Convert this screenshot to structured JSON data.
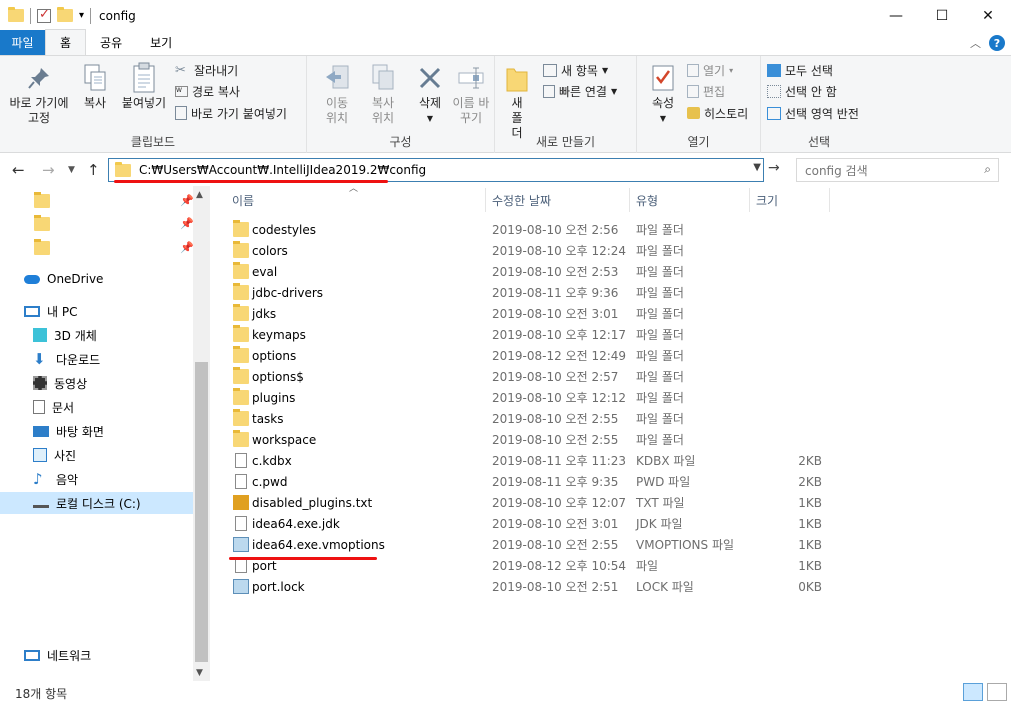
{
  "window": {
    "title": "config",
    "minimize": "—",
    "maximize": "☐",
    "close": "✕"
  },
  "ribbon_tabs": [
    "파일",
    "홈",
    "공유",
    "보기"
  ],
  "ribbon": {
    "clipboard": {
      "label": "클립보드",
      "pin": "바로 가기에 고정",
      "copy": "복사",
      "paste": "붙여넣기",
      "cut": "잘라내기",
      "copy_path": "경로 복사",
      "paste_shortcut": "바로 가기 붙여넣기"
    },
    "organize": {
      "label": "구성",
      "move_to": "이동 위치",
      "copy_to": "복사 위치",
      "delete": "삭제",
      "rename": "이름 바꾸기"
    },
    "new": {
      "label": "새로 만들기",
      "new_folder": "새 폴더",
      "new_item": "새 항목",
      "easy_access": "빠른 연결"
    },
    "open": {
      "label": "열기",
      "properties": "속성",
      "open": "열기",
      "edit": "편집",
      "history": "히스토리"
    },
    "select": {
      "label": "선택",
      "select_all": "모두 선택",
      "select_none": "선택 안 함",
      "invert": "선택 영역 반전"
    }
  },
  "address": {
    "path": "C:₩Users₩Account₩.IntelliJIdea2019.2₩config",
    "search_placeholder": "config 검색"
  },
  "nav_pane": {
    "onedrive": "OneDrive",
    "this_pc": "내 PC",
    "items": [
      "3D 개체",
      "다운로드",
      "동영상",
      "문서",
      "바탕 화면",
      "사진",
      "음악",
      "로컬 디스크 (C:)"
    ],
    "network": "네트워크"
  },
  "columns": {
    "name": "이름",
    "date": "수정한 날짜",
    "type": "유형",
    "size": "크기"
  },
  "files": [
    {
      "name": "codestyles",
      "date": "2019-08-10 오전 2:56",
      "type": "파일 폴더",
      "size": "",
      "kind": "folder"
    },
    {
      "name": "colors",
      "date": "2019-08-10 오후 12:24",
      "type": "파일 폴더",
      "size": "",
      "kind": "folder"
    },
    {
      "name": "eval",
      "date": "2019-08-10 오전 2:53",
      "type": "파일 폴더",
      "size": "",
      "kind": "folder"
    },
    {
      "name": "jdbc-drivers",
      "date": "2019-08-11 오후 9:36",
      "type": "파일 폴더",
      "size": "",
      "kind": "folder"
    },
    {
      "name": "jdks",
      "date": "2019-08-10 오전 3:01",
      "type": "파일 폴더",
      "size": "",
      "kind": "folder"
    },
    {
      "name": "keymaps",
      "date": "2019-08-10 오후 12:17",
      "type": "파일 폴더",
      "size": "",
      "kind": "folder"
    },
    {
      "name": "options",
      "date": "2019-08-12 오전 12:49",
      "type": "파일 폴더",
      "size": "",
      "kind": "folder"
    },
    {
      "name": "options$",
      "date": "2019-08-10 오전 2:57",
      "type": "파일 폴더",
      "size": "",
      "kind": "folder"
    },
    {
      "name": "plugins",
      "date": "2019-08-10 오후 12:12",
      "type": "파일 폴더",
      "size": "",
      "kind": "folder"
    },
    {
      "name": "tasks",
      "date": "2019-08-10 오전 2:55",
      "type": "파일 폴더",
      "size": "",
      "kind": "folder"
    },
    {
      "name": "workspace",
      "date": "2019-08-10 오전 2:55",
      "type": "파일 폴더",
      "size": "",
      "kind": "folder"
    },
    {
      "name": "c.kdbx",
      "date": "2019-08-11 오후 11:23",
      "type": "KDBX 파일",
      "size": "2KB",
      "kind": "file"
    },
    {
      "name": "c.pwd",
      "date": "2019-08-11 오후 9:35",
      "type": "PWD 파일",
      "size": "2KB",
      "kind": "file"
    },
    {
      "name": "disabled_plugins.txt",
      "date": "2019-08-10 오후 12:07",
      "type": "TXT 파일",
      "size": "1KB",
      "kind": "txt"
    },
    {
      "name": "idea64.exe.jdk",
      "date": "2019-08-10 오전 3:01",
      "type": "JDK 파일",
      "size": "1KB",
      "kind": "file"
    },
    {
      "name": "idea64.exe.vmoptions",
      "date": "2019-08-10 오전 2:55",
      "type": "VMOPTIONS 파일",
      "size": "1KB",
      "kind": "vm"
    },
    {
      "name": "port",
      "date": "2019-08-12 오후 10:54",
      "type": "파일",
      "size": "1KB",
      "kind": "file"
    },
    {
      "name": "port.lock",
      "date": "2019-08-10 오전 2:51",
      "type": "LOCK 파일",
      "size": "0KB",
      "kind": "vm"
    }
  ],
  "status": {
    "count": "18개 항목"
  }
}
